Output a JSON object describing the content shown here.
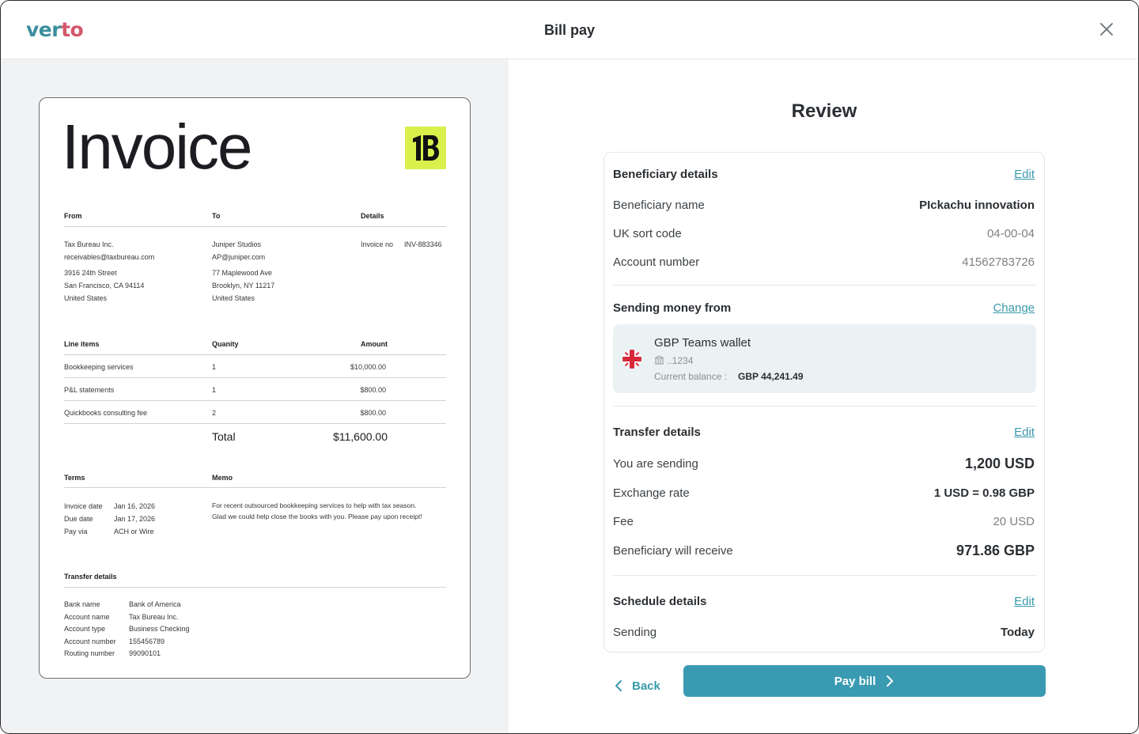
{
  "app": {
    "logo_part1": "ver",
    "logo_part2": "to",
    "title": "Bill pay"
  },
  "invoice": {
    "title": "Invoice",
    "from_label": "From",
    "to_label": "To",
    "details_label": "Details",
    "from_lines": [
      "Tax Bureau Inc.",
      "receivables@taxbureau.com"
    ],
    "from_address": [
      "3916 24th Street",
      "San Francisco, CA 94114",
      "United States"
    ],
    "to_lines": [
      "Juniper Studios",
      "AP@juniper.com"
    ],
    "to_address": [
      "77 Maplewood Ave",
      "Brooklyn, NY 11217",
      "United States"
    ],
    "invoice_no_label": "Invoice no",
    "invoice_no": "INV-883346",
    "line_items_label": "Line items",
    "quantity_label": "Quanity",
    "amount_label": "Amount",
    "items": [
      {
        "name": "Bookkeeping services",
        "qty": "1",
        "amount": "$10,000.00"
      },
      {
        "name": "P&L statements",
        "qty": "1",
        "amount": "$800.00"
      },
      {
        "name": "Quickbooks consulting fee",
        "qty": "2",
        "amount": "$800.00"
      }
    ],
    "total_label": "Total",
    "total": "$11,600.00",
    "terms_label": "Terms",
    "memo_label": "Memo",
    "terms": [
      {
        "label": "Invoice date",
        "value": "Jan 16, 2026"
      },
      {
        "label": "Due date",
        "value": "Jan 17, 2026"
      },
      {
        "label": "Pay via",
        "value": "ACH or Wire"
      }
    ],
    "memo": [
      "For recent outsourced bookkeeping services to help with tax season.",
      "Glad we could help close the books with you. Please pay upon receipt!"
    ],
    "transfer_label": "Transfer details",
    "transfer": [
      {
        "label": "Bank name",
        "value": "Bank of America"
      },
      {
        "label": "Account name",
        "value": "Tax Bureau Inc."
      },
      {
        "label": "Account type",
        "value": "Business Checking"
      },
      {
        "label": "Account number",
        "value": "155456789"
      },
      {
        "label": "Routing number",
        "value": "99090101"
      }
    ]
  },
  "review": {
    "title": "Review",
    "beneficiary": {
      "heading": "Beneficiary details",
      "edit": "Edit",
      "name_label": "Beneficiary name",
      "name": "PIckachu innovation",
      "sort_label": "UK sort code",
      "sort": "04-00-04",
      "acct_label": "Account number",
      "acct": "41562783726"
    },
    "source": {
      "heading": "Sending money from",
      "change": "Change",
      "wallet_name": "GBP Teams wallet",
      "wallet_acct": "..1234",
      "balance_label": "Current balance :",
      "balance": "GBP 44,241.49"
    },
    "transfer": {
      "heading": "Transfer details",
      "edit": "Edit",
      "sending_label": "You are sending",
      "sending": "1,200 USD",
      "rate_label": "Exchange rate",
      "rate": "1 USD = 0.98 GBP",
      "fee_label": "Fee",
      "fee": "20 USD",
      "receive_label": "Beneficiary will receive",
      "receive": "971.86 GBP"
    },
    "schedule": {
      "heading": "Schedule details",
      "edit": "Edit",
      "sending_label": "Sending",
      "sending": "Today"
    },
    "back": "Back",
    "pay": "Pay bill"
  },
  "colors": {
    "accent": "#3a9ab2",
    "logo_teal": "#3b8f9e",
    "logo_pink": "#d4576b",
    "invoice_logo": "#d9ef4c"
  }
}
